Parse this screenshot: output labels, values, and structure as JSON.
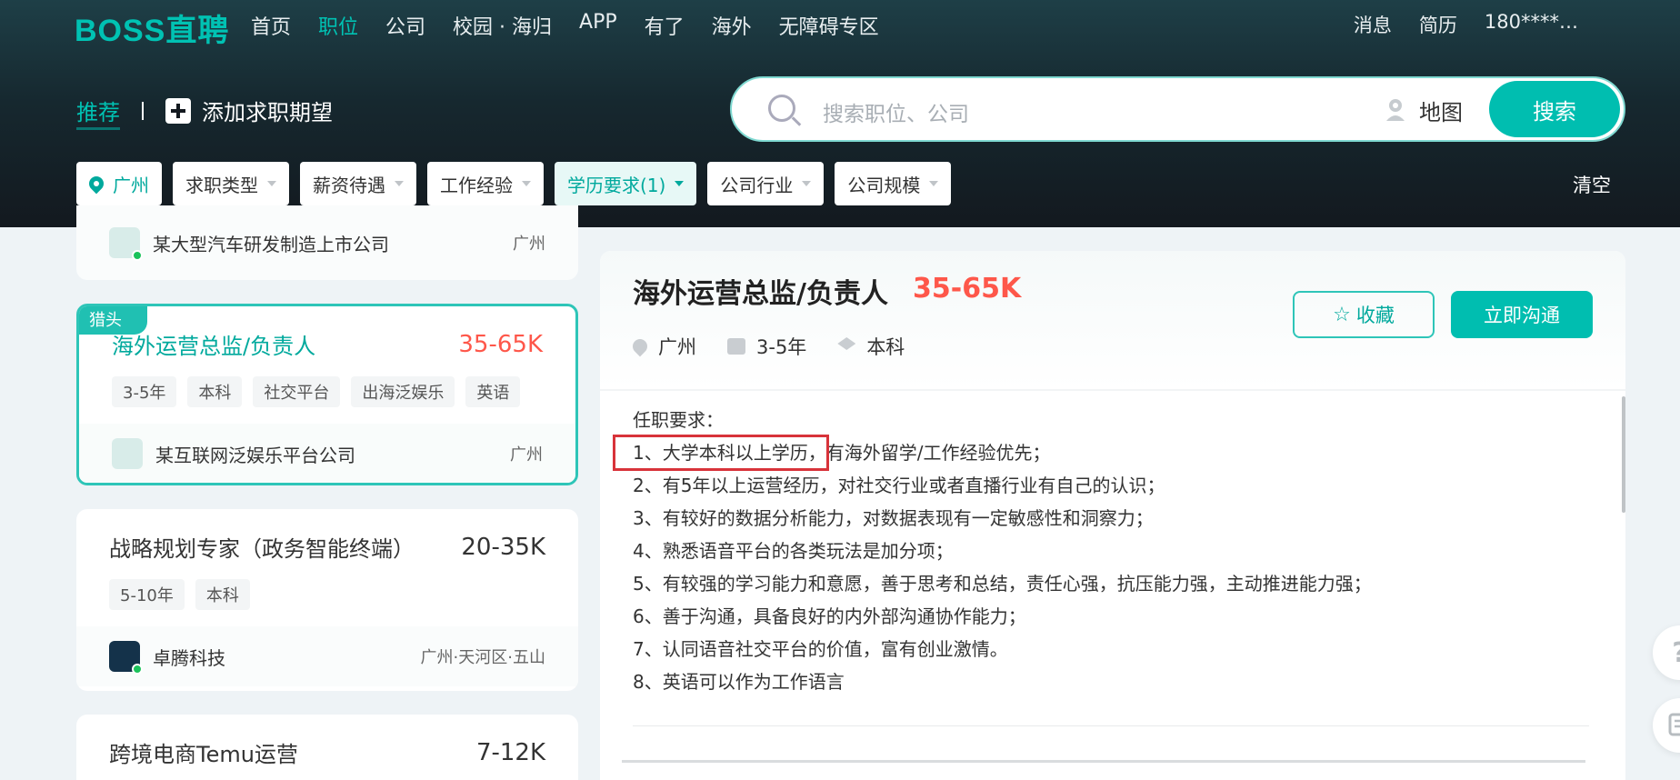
{
  "header": {
    "logo": "BOSS直聘",
    "nav": [
      "首页",
      "职位",
      "公司",
      "校园 · 海归",
      "APP",
      "有了",
      "海外",
      "无障碍专区"
    ],
    "nav_active_index": 1,
    "user_nav": [
      "消息",
      "简历",
      "180****…"
    ]
  },
  "recommend": {
    "tab": "推荐",
    "add_label": "添加求职期望"
  },
  "search": {
    "placeholder": "搜索职位、公司",
    "map_label": "地图",
    "button": "搜索"
  },
  "filters": {
    "city": "广州",
    "items": [
      "求职类型",
      "薪资待遇",
      "工作经验",
      "学历要求(1)",
      "公司行业",
      "公司规模"
    ],
    "active_item": "学历要求(1)",
    "clear": "清空"
  },
  "job_list": {
    "top_company": {
      "name": "某大型汽车研发制造上市公司",
      "city": "广州"
    },
    "selected": {
      "badge": "猎头",
      "title": "海外运营总监/负责人",
      "salary": "35-65K",
      "tags": [
        "3-5年",
        "本科",
        "社交平台",
        "出海泛娱乐",
        "英语"
      ],
      "company": "某互联网泛娱乐平台公司",
      "city": "广州"
    },
    "second": {
      "title": "战略规划专家（政务智能终端）",
      "salary": "20-35K",
      "tags": [
        "5-10年",
        "本科"
      ],
      "company": "卓腾科技",
      "city": "广州·天河区·五山"
    },
    "third": {
      "title": "跨境电商Temu运营",
      "salary": "7-12K"
    }
  },
  "detail": {
    "title": "海外运营总监/负责人",
    "salary": "35-65K",
    "city": "广州",
    "experience": "3-5年",
    "education": "本科",
    "fav_button": "收藏",
    "chat_button": "立即沟通",
    "requirements_heading": "任职要求：",
    "requirements": [
      "1、大学本科以上学历，有海外留学/工作经验优先；",
      "2、有5年以上运营经历，对社交行业或者直播行业有自己的认识；",
      "3、有较好的数据分析能力，对数据表现有一定敏感性和洞察力；",
      "4、熟悉语音平台的各类玩法是加分项；",
      "5、有较强的学习能力和意愿，善于思考和总结，责任心强，抗压能力强，主动推进能力强；",
      "6、善于沟通，具备良好的内外部沟通协作能力；",
      "7、认同语音社交平台的价值，富有创业激情。",
      "8、英语可以作为工作语言"
    ]
  },
  "colors": {
    "accent": "#00beb0",
    "salary": "#fe574a",
    "highlight_box": "#d8333a"
  },
  "side_help": "?"
}
